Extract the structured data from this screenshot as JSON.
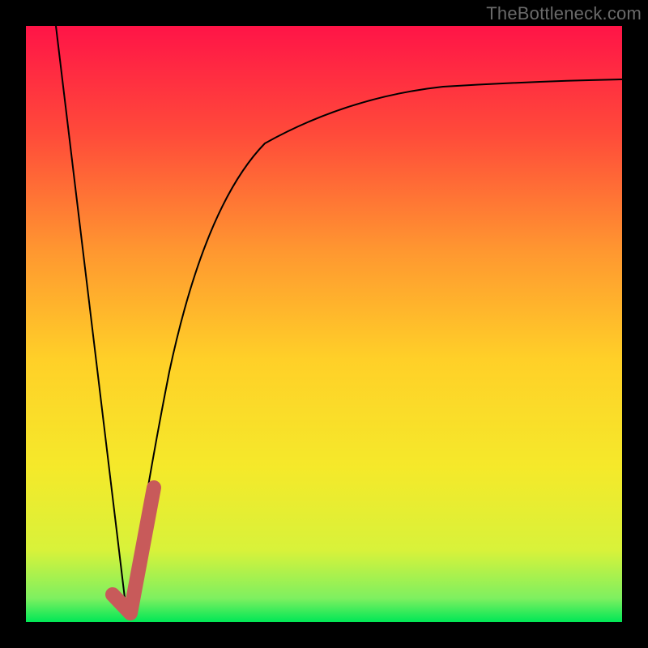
{
  "attribution": "TheBottleneck.com",
  "chart_data": {
    "type": "line",
    "title": "",
    "xlabel": "",
    "ylabel": "",
    "xlim": [
      0,
      100
    ],
    "ylim": [
      0,
      100
    ],
    "grid": false,
    "legend": false,
    "series": [
      {
        "name": "left-falling-line",
        "x": [
          5,
          17
        ],
        "y": [
          100,
          0
        ]
      },
      {
        "name": "rising-saturating-curve",
        "x": [
          17,
          20,
          24,
          30,
          36,
          44,
          54,
          66,
          80,
          92,
          100
        ],
        "y": [
          0,
          22,
          42,
          60,
          70,
          78,
          83,
          87,
          89,
          90.5,
          91
        ]
      },
      {
        "name": "red-highlight-segment",
        "x": [
          14.5,
          17.5,
          21.5
        ],
        "y": [
          4,
          1.5,
          22
        ]
      }
    ],
    "gradient_colors": {
      "top": "#ff1447",
      "mid": "#ffd500",
      "bottom": "#00e756"
    },
    "overlay_line_color": "#c85a5a"
  }
}
